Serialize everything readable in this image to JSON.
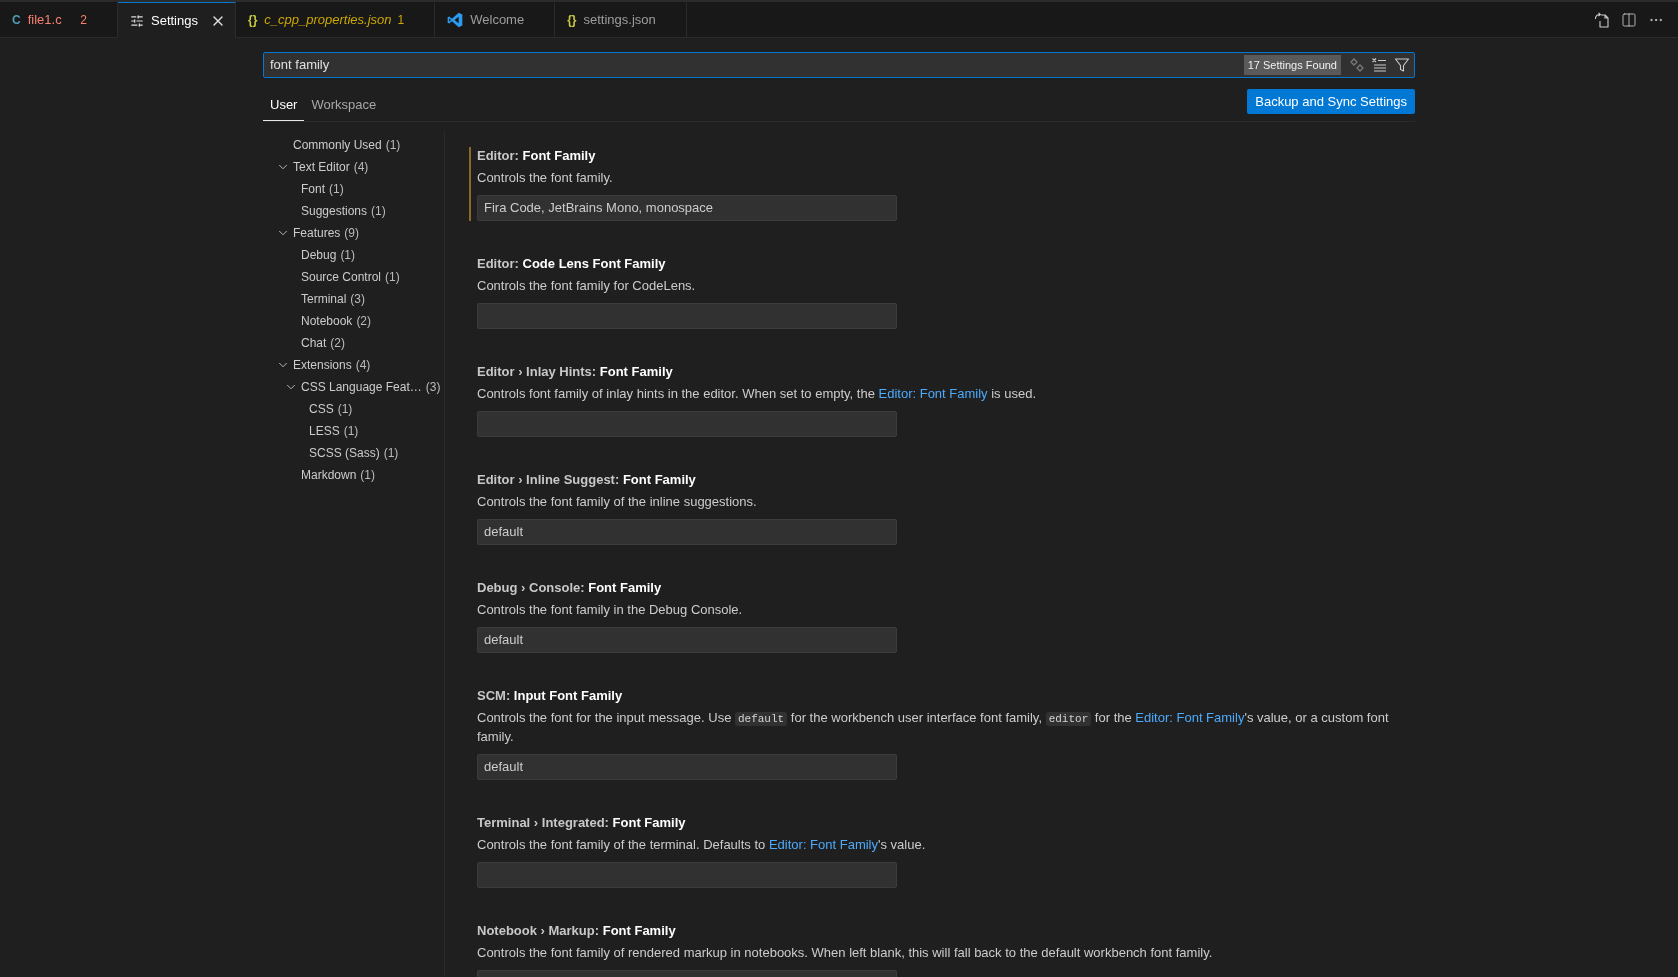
{
  "tabs": [
    {
      "kind": "file",
      "icon": "C",
      "color": "#519aba",
      "label": "file1.c",
      "badge": "2",
      "errors": true,
      "warnings": false,
      "selected": false,
      "preview": false
    },
    {
      "kind": "settings",
      "label": "Settings",
      "errors": false,
      "warnings": false,
      "selected": true,
      "preview": false
    },
    {
      "kind": "file",
      "icon": "{}",
      "color": "#cbcb41",
      "label": "c_cpp_properties.json",
      "badge": "1",
      "errors": false,
      "warnings": true,
      "selected": false,
      "preview": true
    },
    {
      "kind": "welcome",
      "label": "Welcome",
      "errors": false,
      "warnings": false,
      "selected": false,
      "preview": false
    },
    {
      "kind": "file",
      "icon": "{}",
      "color": "#cbcb41",
      "label": "settings.json",
      "errors": false,
      "warnings": false,
      "selected": false,
      "preview": false
    }
  ],
  "search": {
    "value": "font family",
    "result_count": "17 Settings Found",
    "focused": true
  },
  "scope_tabs": [
    {
      "label": "User",
      "selected": true
    },
    {
      "label": "Workspace",
      "selected": false
    }
  ],
  "sync_button": "Backup and Sync Settings",
  "toc": [
    {
      "label": "Commonly Used",
      "count": "(1)"
    },
    {
      "label": "Text Editor",
      "count": "(4)",
      "expanded": true,
      "children": [
        {
          "label": "Font",
          "count": "(1)"
        },
        {
          "label": "Suggestions",
          "count": "(1)"
        }
      ]
    },
    {
      "label": "Features",
      "count": "(9)",
      "expanded": true,
      "children": [
        {
          "label": "Debug",
          "count": "(1)"
        },
        {
          "label": "Source Control",
          "count": "(1)"
        },
        {
          "label": "Terminal",
          "count": "(3)"
        },
        {
          "label": "Notebook",
          "count": "(2)"
        },
        {
          "label": "Chat",
          "count": "(2)"
        }
      ]
    },
    {
      "label": "Extensions",
      "count": "(4)",
      "expanded": true,
      "children": [
        {
          "label": "CSS Language Feat…",
          "count": "(3)",
          "expanded": true,
          "children": [
            {
              "label": "CSS",
              "count": "(1)"
            },
            {
              "label": "LESS",
              "count": "(1)"
            },
            {
              "label": "SCSS (Sass)",
              "count": "(1)"
            }
          ]
        },
        {
          "label": "Markdown",
          "count": "(1)"
        }
      ]
    }
  ],
  "settings": [
    {
      "category": "Editor:",
      "title": "Font Family",
      "modified": true,
      "description": [
        {
          "kind": "text",
          "text": "Controls the font family."
        }
      ],
      "value": "Fira Code, JetBrains Mono, monospace"
    },
    {
      "category": "Editor:",
      "title": "Code Lens Font Family",
      "modified": false,
      "description": [
        {
          "kind": "text",
          "text": "Controls the font family for CodeLens."
        }
      ]
    },
    {
      "category": "Editor › Inlay Hints:",
      "title": "Font Family",
      "modified": false,
      "description": [
        {
          "kind": "text",
          "text": "Controls font family of inlay hints in the editor. When set to empty, the "
        },
        {
          "kind": "link",
          "text": "Editor: Font Family"
        },
        {
          "kind": "text",
          "text": " is used."
        }
      ]
    },
    {
      "category": "Editor › Inline Suggest:",
      "title": "Font Family",
      "modified": false,
      "description": [
        {
          "kind": "text",
          "text": "Controls the font family of the inline suggestions."
        }
      ],
      "value": "default"
    },
    {
      "category": "Debug › Console:",
      "title": "Font Family",
      "modified": false,
      "description": [
        {
          "kind": "text",
          "text": "Controls the font family in the Debug Console."
        }
      ],
      "value": "default"
    },
    {
      "category": "SCM:",
      "title": "Input Font Family",
      "modified": false,
      "description": [
        {
          "kind": "text",
          "text": "Controls the font for the input message. Use "
        },
        {
          "kind": "code",
          "text": "default"
        },
        {
          "kind": "text",
          "text": " for the workbench user interface font family, "
        },
        {
          "kind": "code",
          "text": "editor"
        },
        {
          "kind": "text",
          "text": " for the "
        },
        {
          "kind": "link",
          "text": "Editor: Font Family"
        },
        {
          "kind": "text",
          "text": "'s value, or a custom font family."
        }
      ],
      "value": "default"
    },
    {
      "category": "Terminal › Integrated:",
      "title": "Font Family",
      "modified": false,
      "description": [
        {
          "kind": "text",
          "text": "Controls the font family of the terminal. Defaults to "
        },
        {
          "kind": "link",
          "text": "Editor: Font Family"
        },
        {
          "kind": "text",
          "text": "'s value."
        }
      ]
    },
    {
      "category": "Notebook › Markup:",
      "title": "Font Family",
      "modified": false,
      "description": [
        {
          "kind": "text",
          "text": "Controls the font family of rendered markup in notebooks. When left blank, this will fall back to the default workbench font family."
        }
      ]
    }
  ]
}
